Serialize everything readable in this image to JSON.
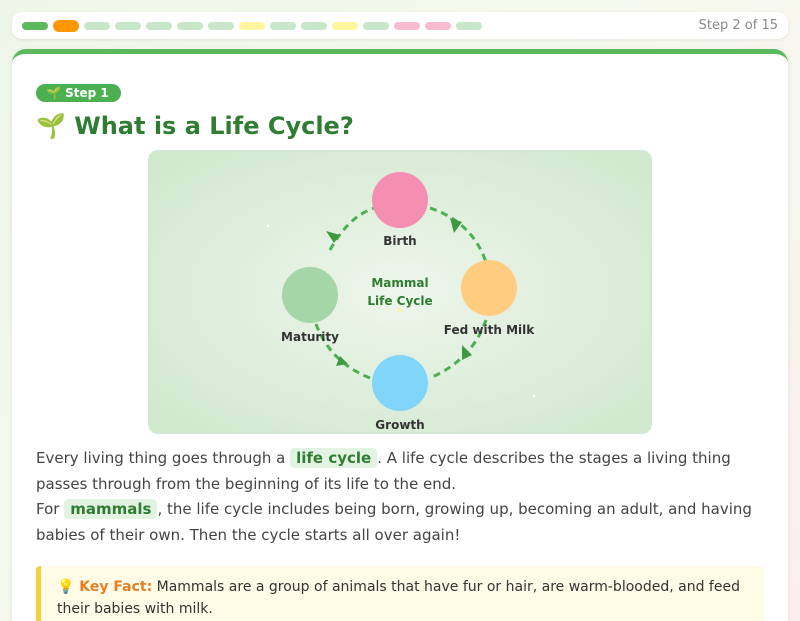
{
  "progress": {
    "pips": [
      {
        "color": "#5cb85c",
        "state": "done"
      },
      {
        "color": "#ff9800",
        "state": "current"
      },
      {
        "color": "#c8e6c9",
        "state": "todo"
      },
      {
        "color": "#c8e6c9",
        "state": "todo"
      },
      {
        "color": "#c8e6c9",
        "state": "todo"
      },
      {
        "color": "#c8e6c9",
        "state": "todo"
      },
      {
        "color": "#c8e6c9",
        "state": "todo"
      },
      {
        "color": "#fff59d",
        "state": "todo"
      },
      {
        "color": "#c8e6c9",
        "state": "todo"
      },
      {
        "color": "#c8e6c9",
        "state": "todo"
      },
      {
        "color": "#fff59d",
        "state": "todo"
      },
      {
        "color": "#c8e6c9",
        "state": "todo"
      },
      {
        "color": "#f8bbd0",
        "state": "todo"
      },
      {
        "color": "#f8bbd0",
        "state": "todo"
      },
      {
        "color": "#c8e6c9",
        "state": "todo"
      }
    ],
    "label": "Step 2 of 15"
  },
  "lesson": {
    "badge": "🌱 Step 1",
    "title": "🌱 What is a Life Cycle?",
    "diagram": {
      "center_line1": "Mammal",
      "center_line2": "Life Cycle",
      "stages": [
        {
          "label": "Birth",
          "color": "#f48fb1"
        },
        {
          "label": "Fed with Milk",
          "color": "#ffcc80"
        },
        {
          "label": "Growth",
          "color": "#81d4fa"
        },
        {
          "label": "Maturity",
          "color": "#a5d6a7"
        }
      ],
      "arrow_color": "#4caf50"
    },
    "para1": {
      "before": "Every living thing goes through a",
      "highlight": "life cycle",
      "after": ". A life cycle describes the stages a living thing passes through from the beginning of its life to the end."
    },
    "para2": {
      "before": "For",
      "highlight": "mammals",
      "after": ", the life cycle includes being born, growing up, becoming an adult, and having babies of their own. Then the cycle starts all over again!"
    },
    "fact": {
      "label": "💡 Key Fact:",
      "text": "Mammals are a group of animals that have fur or hair, are warm-blooded, and feed their babies with milk."
    }
  }
}
